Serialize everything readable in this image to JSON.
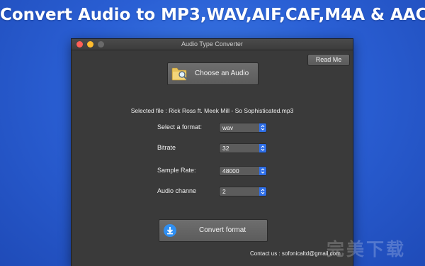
{
  "banner": {
    "title": "Convert Audio to MP3,WAV,AIF,CAF,M4A & AAC"
  },
  "window": {
    "title": "Audio Type Converter",
    "read_me_label": "Read Me",
    "choose_label": "Choose an Audio",
    "selected_file": "Selected file : Rick Ross ft. Meek Mill - So Sophisticated.mp3",
    "fields": [
      {
        "label": "Select a format:",
        "value": "wav"
      },
      {
        "label": "Bitrate",
        "value": "32"
      },
      {
        "label": "Sample Rate:",
        "value": "48000"
      },
      {
        "label": "Audio channe",
        "value": "2"
      }
    ],
    "convert_label": "Convert format",
    "contact": "Contact us : sofonicaltd@gmail.com"
  },
  "watermark": {
    "text": "完美下载"
  },
  "colors": {
    "background": "#2a5fd4",
    "window": "#3a3a3a",
    "accent": "#2f6fe8",
    "button": "#5c5c5c"
  },
  "icons": {
    "choose": "folder-search-icon",
    "convert": "download-icon",
    "select": "chevron-up-down-icon"
  }
}
